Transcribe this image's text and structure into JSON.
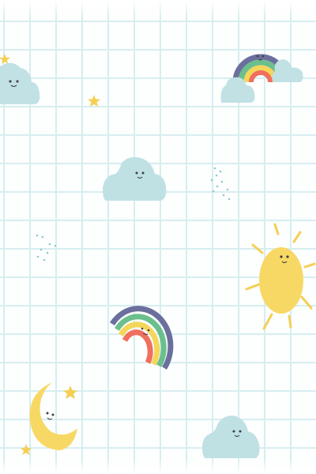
{
  "background": {
    "style": "grid-paper",
    "paper_color": "#fdfefe",
    "grid_color": "#d6eef0"
  },
  "illustrations": {
    "cloud_color": "#bfe1e4",
    "sun_color": "#f8d864",
    "moon_color": "#f8d864",
    "star_color": "#f5cf54",
    "rainbow_colors": [
      "#6b6f9d",
      "#6bbf8c",
      "#f4d65a",
      "#f06f5e"
    ],
    "icons": [
      "cloud-icon",
      "star-icon",
      "rainbow-icon",
      "sun-icon",
      "moon-icon",
      "raindrops-icon"
    ]
  }
}
